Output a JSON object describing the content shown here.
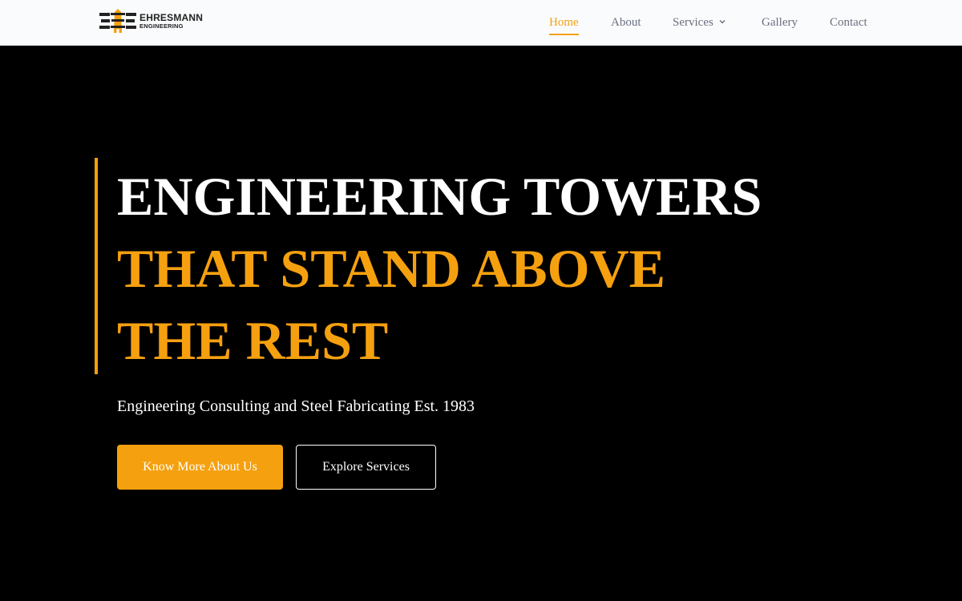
{
  "brand": {
    "name": "EHRESMANN",
    "subtitle": "ENGINEERING",
    "colors": {
      "accent": "#f5a00f",
      "dark": "#222222",
      "background": "#000000"
    }
  },
  "nav": {
    "items": [
      {
        "label": "Home",
        "active": true
      },
      {
        "label": "About",
        "active": false
      },
      {
        "label": "Services",
        "active": false,
        "has_dropdown": true
      },
      {
        "label": "Gallery",
        "active": false
      },
      {
        "label": "Contact",
        "active": false
      }
    ]
  },
  "hero": {
    "headline_line1": "ENGINEERING TOWERS",
    "headline_line2": "THAT STAND ABOVE",
    "headline_line3": "THE REST",
    "tagline": "Engineering Consulting and Steel Fabricating Est. 1983",
    "primary_button": "Know More About Us",
    "secondary_button": "Explore Services"
  }
}
